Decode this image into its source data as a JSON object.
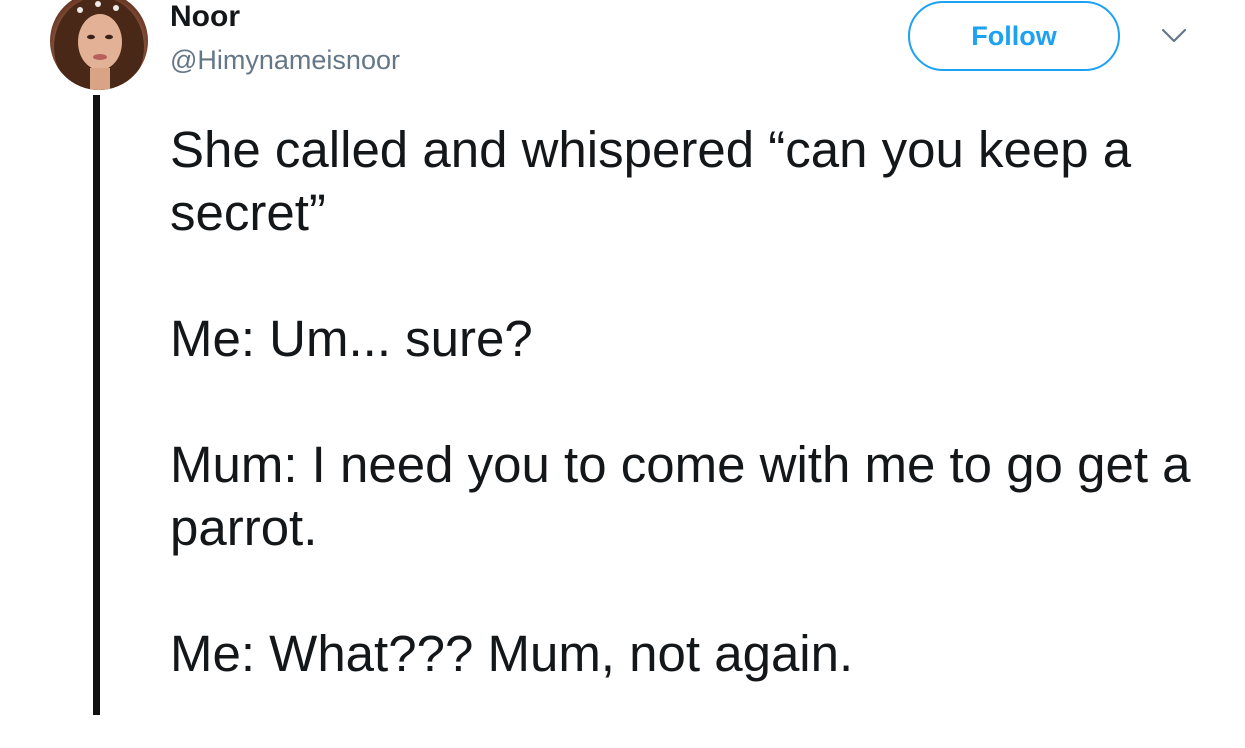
{
  "author": {
    "name": "Noor",
    "handle": "@Himynameisnoor"
  },
  "follow_button": {
    "label": "Follow"
  },
  "menu": {
    "icon": "chevron-down-icon"
  },
  "tweet": {
    "paragraphs": [
      "She called and whispered “can you keep a secret”",
      "Me: Um... sure?",
      "Mum: I need you to come with me to go get a parrot.",
      "Me: What??? Mum, not again."
    ]
  },
  "colors": {
    "accent": "#1da1f2",
    "text": "#14171a",
    "secondary_text": "#657786",
    "thread_line": "#111111"
  }
}
